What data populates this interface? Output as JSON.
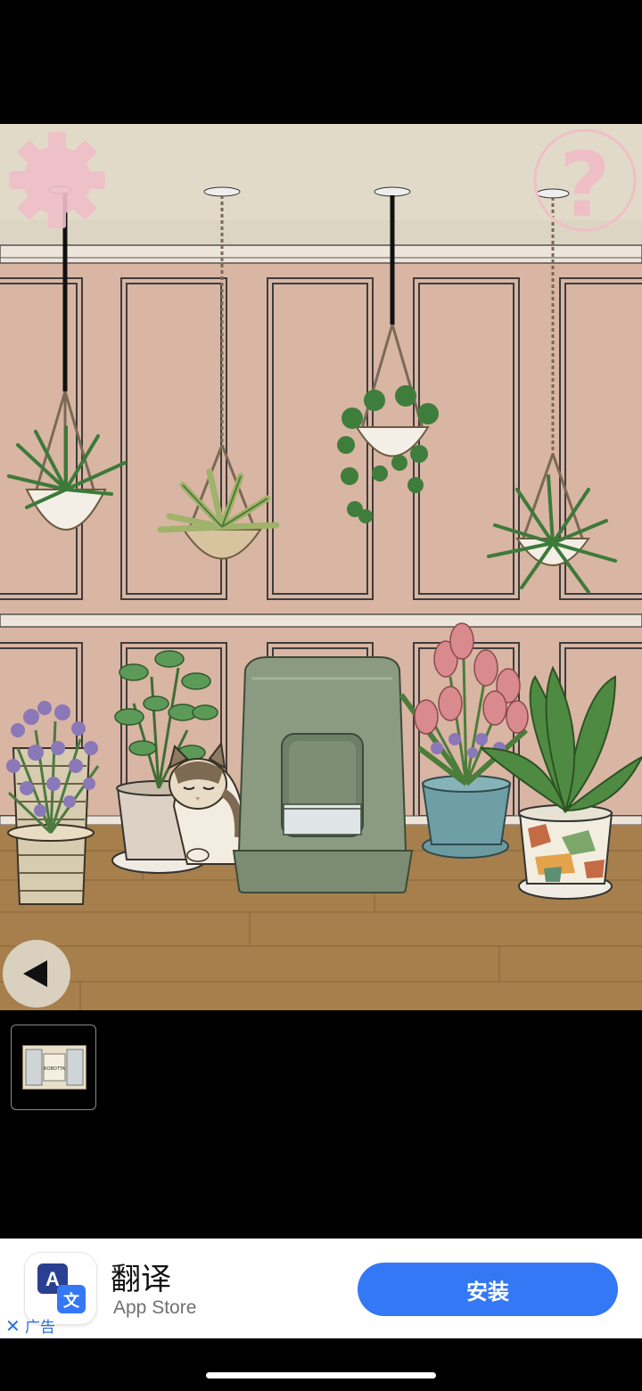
{
  "colors": {
    "ceiling": "#e2dac9",
    "wall": "#d9b5a3",
    "floor": "#a67f4c",
    "litter_box": "#7f9179",
    "install_button": "#3478f6",
    "ui_pink": "#efbfc7"
  },
  "scene": {
    "items": [
      {
        "name": "hanging-spider-plant-left"
      },
      {
        "name": "hanging-dracaena-plant"
      },
      {
        "name": "hanging-ivy-plant"
      },
      {
        "name": "hanging-spider-plant-right"
      },
      {
        "name": "lavender-pot"
      },
      {
        "name": "mint-plant-pot"
      },
      {
        "name": "cat"
      },
      {
        "name": "cat-litter-box"
      },
      {
        "name": "tulip-pot"
      },
      {
        "name": "camo-pot-plant"
      }
    ]
  },
  "hud": {
    "settings_icon": "gear-icon",
    "help_icon": "question-mark-icon",
    "help_text": "?",
    "back_icon": "left-triangle-icon"
  },
  "inventory": {
    "slots": [
      {
        "item": "framed-sign-item",
        "item_text": "ROBOTTA"
      }
    ]
  },
  "ad": {
    "app_name": "翻译",
    "store": "App Store",
    "install_label": "安装",
    "close_icon": "close-icon",
    "close_text": "✕",
    "ad_label": "广告",
    "icon": "translate-app-icon",
    "icon_letter_a": "A",
    "icon_letter_wen": "文"
  }
}
